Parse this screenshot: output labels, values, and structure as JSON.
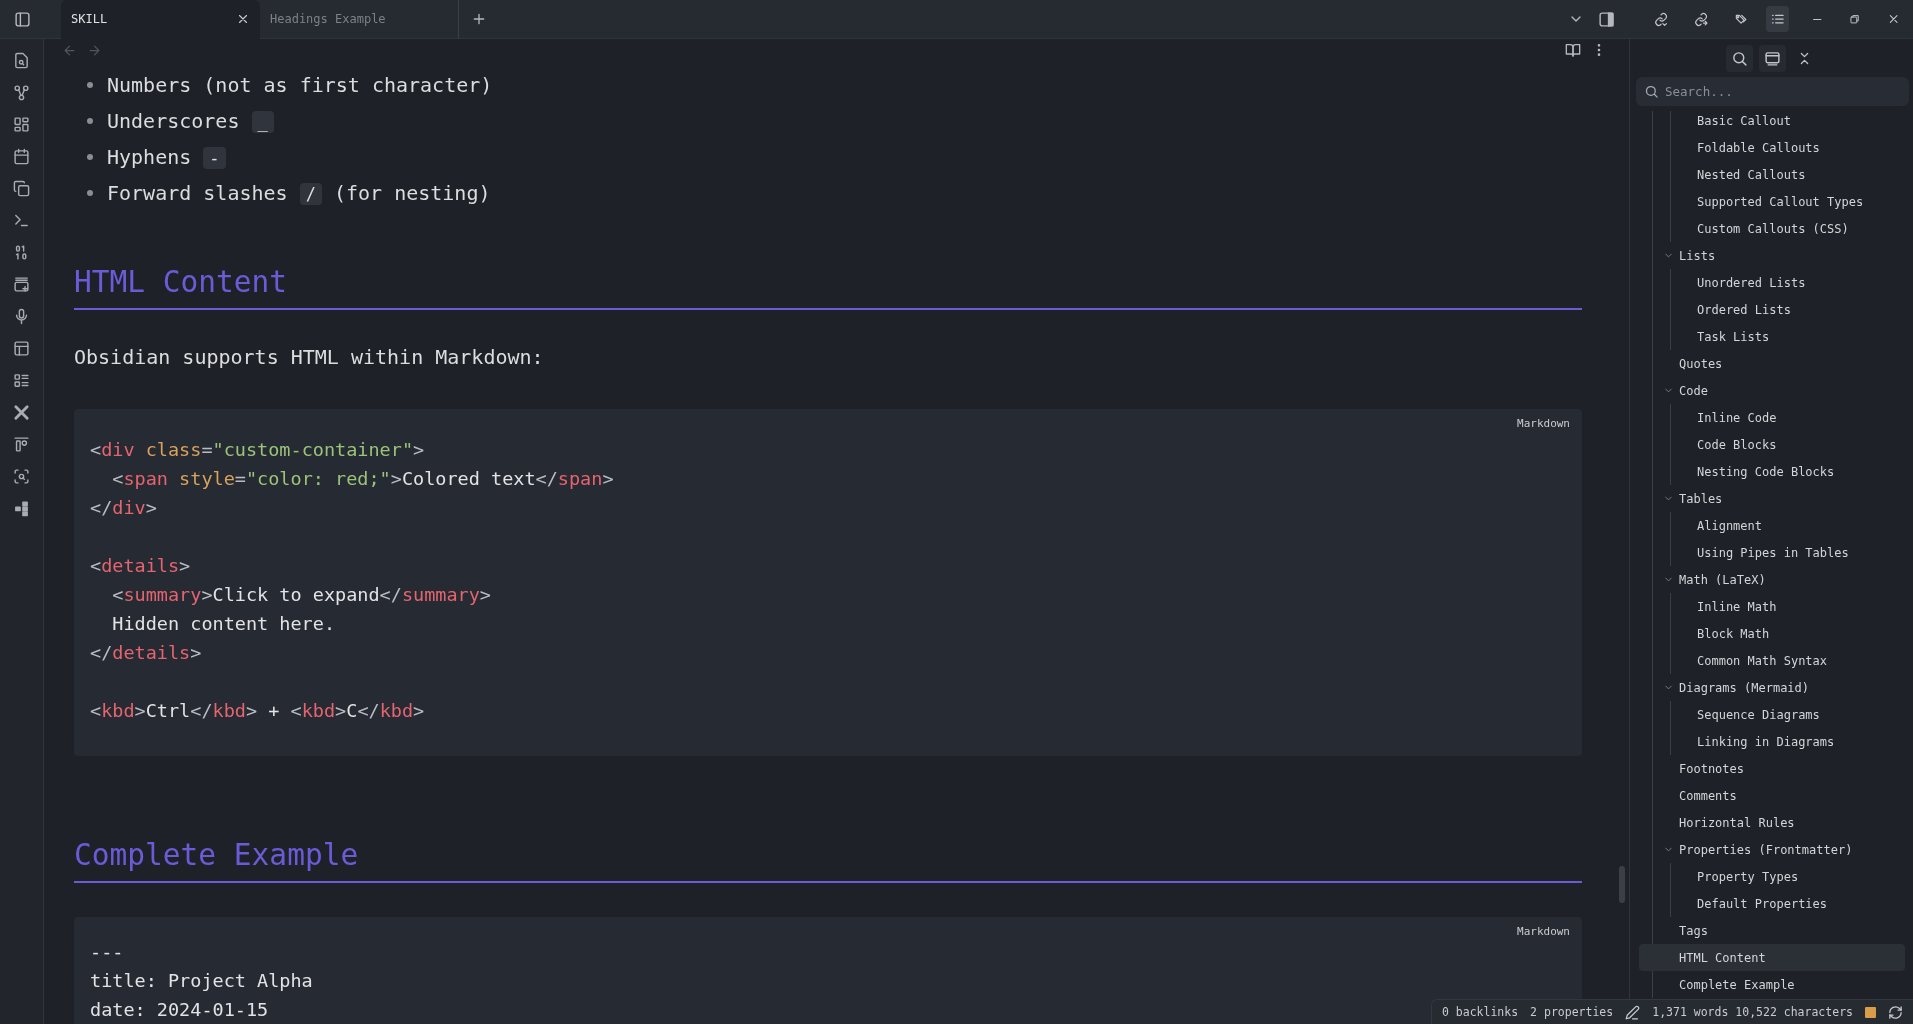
{
  "tabs": [
    {
      "title": "SKILL",
      "selected": true
    },
    {
      "title": "Headings Example",
      "selected": false
    }
  ],
  "editor": {
    "blocks": [
      {
        "kind": "list",
        "items": [
          {
            "text": "Numbers (not as first character)"
          },
          {
            "text": "Underscores",
            "code": "_"
          },
          {
            "text": "Hyphens",
            "code": "-"
          },
          {
            "text": "Forward slashes",
            "code": "/",
            "after": "(for nesting)"
          }
        ]
      },
      {
        "kind": "heading",
        "text": "HTML Content"
      },
      {
        "kind": "paragraph",
        "text": "Obsidian supports HTML within Markdown:"
      },
      {
        "kind": "code",
        "language": "Markdown",
        "groups": [
          [
            [
              {
                "kind": "punct",
                "s": "<"
              },
              {
                "kind": "tag",
                "s": "div"
              },
              {
                "kind": "attr",
                "s": " class"
              },
              {
                "kind": "punct",
                "s": "="
              },
              {
                "kind": "string",
                "s": "\"custom-container\""
              },
              {
                "kind": "punct",
                "s": ">"
              }
            ],
            [
              {
                "kind": "punct",
                "s": "  <"
              },
              {
                "kind": "tag",
                "s": "span"
              },
              {
                "kind": "attr",
                "s": " style"
              },
              {
                "kind": "punct",
                "s": "="
              },
              {
                "kind": "string",
                "s": "\"color: red;\""
              },
              {
                "kind": "punct",
                "s": ">"
              },
              {
                "kind": "text",
                "s": "Colored text"
              },
              {
                "kind": "punct",
                "s": "</"
              },
              {
                "kind": "tag",
                "s": "span"
              },
              {
                "kind": "punct",
                "s": ">"
              }
            ],
            [
              {
                "kind": "punct",
                "s": "</"
              },
              {
                "kind": "tag",
                "s": "div"
              },
              {
                "kind": "punct",
                "s": ">"
              }
            ]
          ],
          [
            [
              {
                "kind": "punct",
                "s": "<"
              },
              {
                "kind": "tag",
                "s": "details"
              },
              {
                "kind": "punct",
                "s": ">"
              }
            ],
            [
              {
                "kind": "punct",
                "s": "  <"
              },
              {
                "kind": "tag",
                "s": "summary"
              },
              {
                "kind": "punct",
                "s": ">"
              },
              {
                "kind": "text",
                "s": "Click to expand"
              },
              {
                "kind": "punct",
                "s": "</"
              },
              {
                "kind": "tag",
                "s": "summary"
              },
              {
                "kind": "punct",
                "s": ">"
              }
            ],
            [
              {
                "kind": "text",
                "s": "  Hidden content here."
              }
            ],
            [
              {
                "kind": "punct",
                "s": "</"
              },
              {
                "kind": "tag",
                "s": "details"
              },
              {
                "kind": "punct",
                "s": ">"
              }
            ]
          ],
          [
            [
              {
                "kind": "punct",
                "s": "<"
              },
              {
                "kind": "tag",
                "s": "kbd"
              },
              {
                "kind": "punct",
                "s": ">"
              },
              {
                "kind": "text",
                "s": "Ctrl"
              },
              {
                "kind": "punct",
                "s": "</"
              },
              {
                "kind": "tag",
                "s": "kbd"
              },
              {
                "kind": "punct",
                "s": ">"
              },
              {
                "kind": "text",
                "s": " + "
              },
              {
                "kind": "punct",
                "s": "<"
              },
              {
                "kind": "tag",
                "s": "kbd"
              },
              {
                "kind": "punct",
                "s": ">"
              },
              {
                "kind": "text",
                "s": "C"
              },
              {
                "kind": "punct",
                "s": "</"
              },
              {
                "kind": "tag",
                "s": "kbd"
              },
              {
                "kind": "punct",
                "s": ">"
              }
            ]
          ]
        ]
      },
      {
        "kind": "heading",
        "text": "Complete Example"
      },
      {
        "kind": "code",
        "language": "Markdown",
        "groups": [
          [
            [
              {
                "kind": "text",
                "s": "---"
              }
            ],
            [
              {
                "kind": "text",
                "s": "title: Project Alpha"
              }
            ],
            [
              {
                "kind": "text",
                "s": "date: 2024-01-15"
              }
            ]
          ]
        ]
      }
    ]
  },
  "outline": {
    "search": {
      "placeholder": "Search..."
    },
    "items": [
      {
        "children": [
          {
            "children": [
              {
                "label": "Basic Callout",
                "selected": false
              },
              {
                "label": "Foldable Callouts",
                "selected": false
              },
              {
                "label": "Nested Callouts",
                "selected": false
              },
              {
                "label": "Supported Callout Types",
                "selected": false
              },
              {
                "label": "Custom Callouts (CSS)",
                "selected": false
              }
            ]
          },
          {
            "label": "Lists",
            "selected": false,
            "expanded": true,
            "children": [
              {
                "label": "Unordered Lists",
                "selected": false
              },
              {
                "label": "Ordered Lists",
                "selected": false
              },
              {
                "label": "Task Lists",
                "selected": false
              }
            ]
          },
          {
            "label": "Quotes",
            "selected": false
          },
          {
            "label": "Code",
            "selected": false,
            "expanded": true,
            "children": [
              {
                "label": "Inline Code",
                "selected": false
              },
              {
                "label": "Code Blocks",
                "selected": false
              },
              {
                "label": "Nesting Code Blocks",
                "selected": false
              }
            ]
          },
          {
            "label": "Tables",
            "selected": false,
            "expanded": true,
            "children": [
              {
                "label": "Alignment",
                "selected": false
              },
              {
                "label": "Using Pipes in Tables",
                "selected": false
              }
            ]
          },
          {
            "label": "Math (LaTeX)",
            "selected": false,
            "expanded": true,
            "children": [
              {
                "label": "Inline Math",
                "selected": false
              },
              {
                "label": "Block Math",
                "selected": false
              },
              {
                "label": "Common Math Syntax",
                "selected": false
              }
            ]
          },
          {
            "label": "Diagrams (Mermaid)",
            "selected": false,
            "expanded": true,
            "children": [
              {
                "label": "Sequence Diagrams",
                "selected": false
              },
              {
                "label": "Linking in Diagrams",
                "selected": false
              }
            ]
          },
          {
            "label": "Footnotes",
            "selected": false
          },
          {
            "label": "Comments",
            "selected": false
          },
          {
            "label": "Horizontal Rules",
            "selected": false
          },
          {
            "label": "Properties (Frontmatter)",
            "selected": false,
            "expanded": true,
            "children": [
              {
                "label": "Property Types",
                "selected": false
              },
              {
                "label": "Default Properties",
                "selected": false
              }
            ]
          },
          {
            "label": "Tags",
            "selected": false
          },
          {
            "label": "HTML Content",
            "selected": true
          },
          {
            "label": "Complete Example",
            "selected": false
          }
        ]
      }
    ]
  },
  "status_bar": {
    "backlinks": "0 backlinks",
    "properties": "2 properties",
    "counts": "1,371 words 10,522 characters"
  }
}
